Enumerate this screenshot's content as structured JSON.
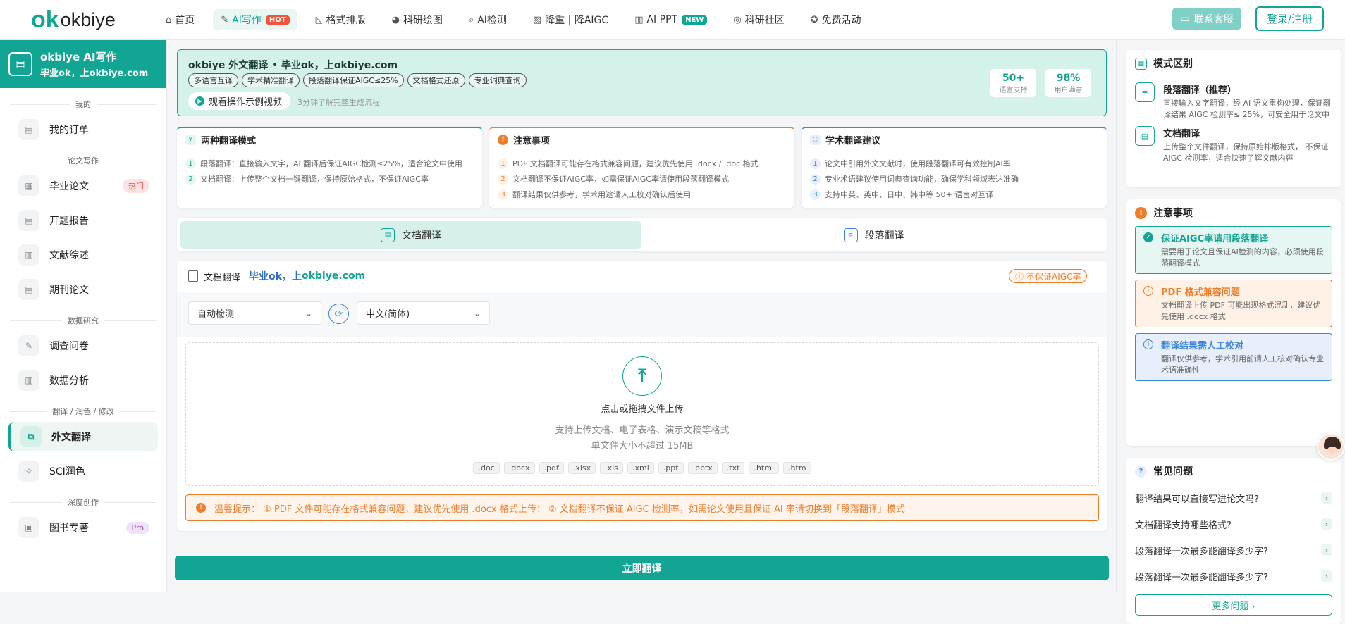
{
  "header": {
    "logo_mark": "ok",
    "logo_text": "okbiye",
    "nav": [
      {
        "label": "首页",
        "icon": "home-icon",
        "glyph": "⌂"
      },
      {
        "label": "AI写作",
        "icon": "pen-icon",
        "glyph": "✎",
        "tag": "HOT"
      },
      {
        "label": "格式排版",
        "icon": "ruler-icon",
        "glyph": "◺"
      },
      {
        "label": "科研绘图",
        "icon": "palette-icon",
        "glyph": "◕"
      },
      {
        "label": "AI检测",
        "icon": "magnifier-icon",
        "glyph": "⌕"
      },
      {
        "label": "降重 | 降AIGC",
        "icon": "chart-icon",
        "glyph": "▧"
      },
      {
        "label": "AI PPT",
        "icon": "bar-chart-icon",
        "glyph": "▥",
        "tag": "NEW"
      },
      {
        "label": "科研社区",
        "icon": "globe-icon",
        "glyph": "◎"
      },
      {
        "label": "免费活动",
        "icon": "medal-icon",
        "glyph": "✪"
      }
    ],
    "contact_label": "联系客服",
    "login_label": "登录/注册"
  },
  "sidebar": {
    "brand_title": "okbiye AI写作",
    "brand_sub": "毕业ok，上okbiye.com",
    "sections": {
      "mine": "我的",
      "paper": "论文写作",
      "research": "数据研究",
      "translate": "翻译 / 润色 / 修改",
      "deep": "深度创作"
    },
    "items": {
      "orders": "我的订单",
      "thesis": "毕业论文",
      "thesis_badge": "热门",
      "proposal": "开题报告",
      "review": "文献综述",
      "journal": "期刊论文",
      "survey": "调查问卷",
      "analysis": "数据分析",
      "translate": "外文翻译",
      "sci": "SCI润色",
      "book": "图书专著",
      "book_badge": "Pro"
    }
  },
  "banner": {
    "title": "okbiye 外文翻译 • 毕业ok，上okbiye.com",
    "pills": [
      "多语言互译",
      "学术精准翻译",
      "段落翻译保证AIGC≤25%",
      "文档格式还原",
      "专业词典查询"
    ],
    "video_label": "观看操作示例视频",
    "video_hint": "3分钟了解完整生成流程",
    "stats": [
      {
        "value": "50+",
        "label": "语言支持"
      },
      {
        "value": "98%",
        "label": "用户满意"
      }
    ]
  },
  "cards": [
    {
      "title": "两种翻译模式",
      "rows": [
        "段落翻译：直接输入文字，AI 翻译后保证AIGC检测≤25%，适合论文中使用",
        "文档翻译：上传整个文档一键翻译，保持原始格式，不保证AIGC率"
      ]
    },
    {
      "title": "注意事项",
      "rows": [
        "PDF 文档翻译可能存在格式兼容问题，建议优先使用 .docx / .doc 格式",
        "文档翻译不保证AIGC率，如需保证AIGC率请使用段落翻译模式",
        "翻译结果仅供参考，学术用途请人工校对确认后使用"
      ]
    },
    {
      "title": "学术翻译建议",
      "rows": [
        "论文中引用外文文献时，使用段落翻译可有效控制AI率",
        "专业术语建议使用词典查询功能，确保学科领域表达准确",
        "支持中英、英中、日中、韩中等 50+ 语言对互译"
      ]
    }
  ],
  "tabs": {
    "doc": "文档翻译",
    "para": "段落翻译"
  },
  "panel": {
    "title": "文档翻译",
    "brand_a": "毕业ok，上",
    "brand_b": "okbiye.com",
    "warn_badge": "不保证AIGC率",
    "source_lang": "自动检测",
    "target_lang": "中文(简体)",
    "upload_title": "点击或拖拽文件上传",
    "upload_desc": "支持上传文档、电子表格、演示文稿等格式",
    "upload_limit": "单文件大小不超过 15MB",
    "exts": [
      ".doc",
      ".docx",
      ".pdf",
      ".xlsx",
      ".xls",
      ".xml",
      ".ppt",
      ".pptx",
      ".txt",
      ".html",
      ".htm"
    ],
    "tip": "温馨提示： ① PDF 文件可能存在格式兼容问题，建议优先使用 .docx 格式上传； ② 文档翻译不保证 AIGC 检测率，如需论文使用且保证 AI 率请切换到「段落翻译」模式"
  },
  "submit_label": "立即翻译",
  "right": {
    "modes_title": "模式区别",
    "modes": [
      {
        "title": "段落翻译（推荐）",
        "desc": "直接输入文字翻译，经 AI 语义重构处理，保证翻译结果 AIGC 检测率≤ 25%，可安全用于论文中"
      },
      {
        "title": "文档翻译",
        "desc": "上传整个文件翻译，保持原始排版格式， 不保证 AIGC 检测率，适合快速了解文献内容"
      }
    ],
    "notes_title": "注意事项",
    "notes": [
      {
        "title": "保证AIGC率请用段落翻译",
        "desc": "需要用于论文且保证AI检测的内容，必须使用段落翻译模式"
      },
      {
        "title": "PDF 格式兼容问题",
        "desc": "文档翻译上传 PDF 可能出现格式混乱，建议优先使用 .docx 格式"
      },
      {
        "title": "翻译结果需人工校对",
        "desc": "翻译仅供参考，学术引用前请人工核对确认专业术语准确性"
      }
    ],
    "faq_title": "常见问题",
    "faq": [
      "翻译结果可以直接写进论文吗?",
      "文档翻译支持哪些格式?",
      "段落翻译一次最多能翻译多少字?",
      "段落翻译一次最多能翻译多少字?"
    ],
    "more_label": "更多问题 ›"
  },
  "colors": {
    "accent": "#12a594",
    "orange": "#f07d2a",
    "blue": "#3b82e6",
    "hot": "#f2553a"
  }
}
